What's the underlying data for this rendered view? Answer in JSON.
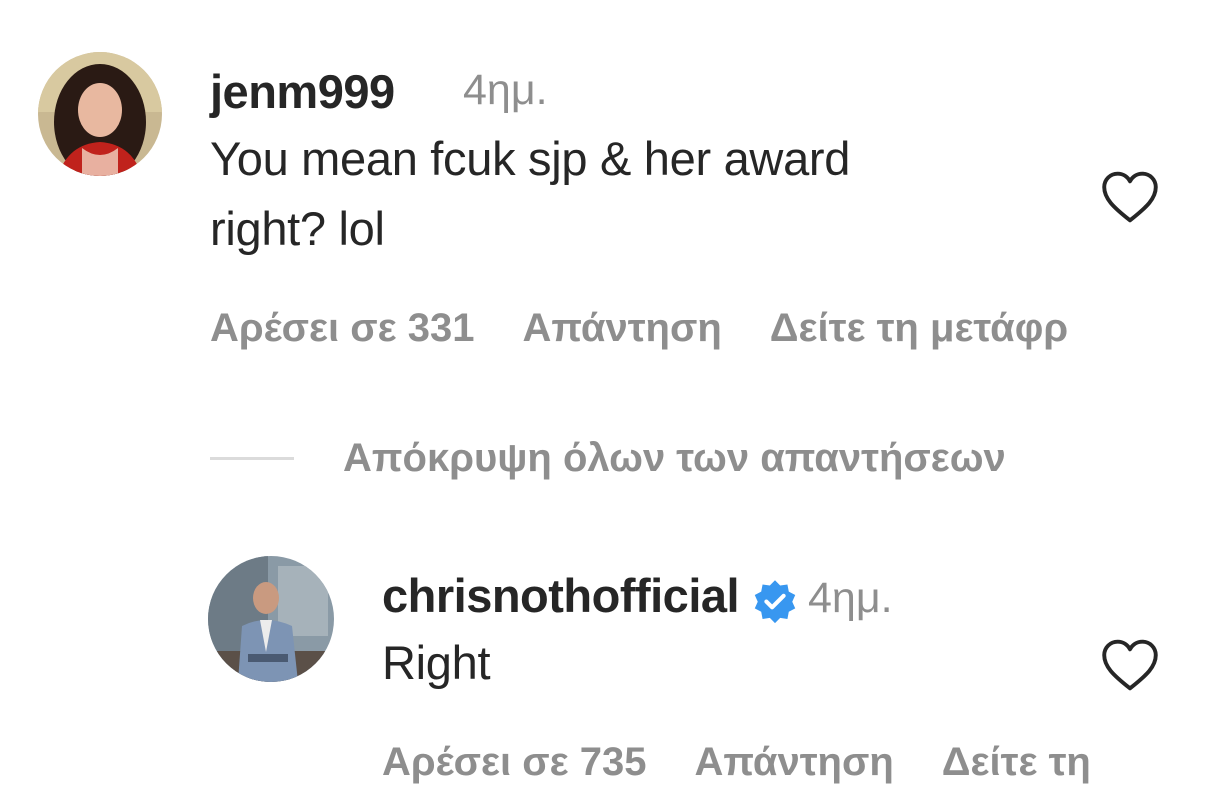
{
  "comment": {
    "username": "jenm999",
    "time": "4ημ.",
    "text_line1": "You mean fcuk sjp & her award",
    "text_line2": "right? lol",
    "likes": "Αρέσει σε 331",
    "reply_label": "Απάντηση",
    "translation_label": "Δείτε τη μετάφρ"
  },
  "replies_toggle": {
    "label": "Απόκρυψη όλων των απαντήσεων"
  },
  "reply": {
    "username": "chrisnothofficial",
    "time": "4ημ.",
    "text": "Right",
    "likes": "Αρέσει σε 735",
    "reply_label": "Απάντηση",
    "translation_label": "Δείτε τη"
  },
  "colors": {
    "text": "#262626",
    "muted": "#8e8e8e",
    "verified": "#3897f0",
    "divider": "#dbdbdb"
  },
  "icons": {
    "like": "heart-outline-icon",
    "verified": "verified-badge-icon"
  }
}
